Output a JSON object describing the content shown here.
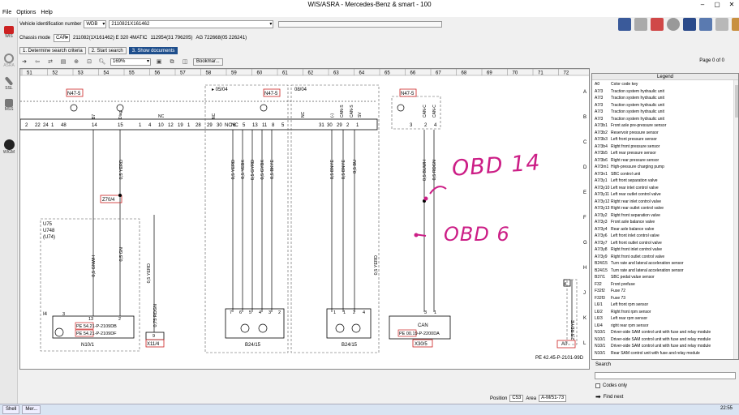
{
  "window": {
    "title": "WIS/ASRA - Mercedes-Benz & smart - 100",
    "controls": [
      "–",
      "▢",
      "✕"
    ]
  },
  "menu": [
    "File",
    "Options",
    "Help"
  ],
  "leftbar": [
    {
      "label": "WIS",
      "icon": "toolbox-icon",
      "color": "#cc2222"
    },
    {
      "label": "ASRA",
      "icon": "gauge-icon",
      "color": "#888888"
    },
    {
      "label": "SSL",
      "icon": "wrench-icon",
      "color": "#666666"
    },
    {
      "label": "MSS",
      "icon": "tools-icon",
      "color": "#666666"
    },
    {
      "label": "WIGM",
      "icon": "circle-play-icon",
      "color": "#222222"
    }
  ],
  "vin": {
    "label": "Vehicle identification number",
    "prefix": "WDB",
    "value": "2110821X161462"
  },
  "chassis": {
    "label": "Chassis mode",
    "car": "CAR",
    "model": "211082(1X161462) E 320 4MATIC",
    "engine": "112954(31 796205)",
    "trans": "AG 722668(05 226241)"
  },
  "steps": [
    {
      "label": "1. Determine search criteria",
      "active": false
    },
    {
      "label": "2. Start search",
      "active": false
    },
    {
      "label": "3. Show documents",
      "active": true
    }
  ],
  "toolbar": {
    "zoom": "169%",
    "bookmark": "Bookmar...",
    "page": "Page 0 of 0"
  },
  "diagram": {
    "col_numbers": [
      "51",
      "52",
      "53",
      "54",
      "55",
      "56",
      "57",
      "58",
      "59",
      "60",
      "61",
      "62",
      "63",
      "64",
      "65",
      "66",
      "67",
      "68",
      "69",
      "70",
      "71",
      "72"
    ],
    "row_letters": [
      "A",
      "B",
      "C",
      "D",
      "E",
      "F",
      "G",
      "H",
      "J",
      "K",
      "L"
    ],
    "boxes": [
      "N47-5",
      "N47-5",
      "N47-5"
    ],
    "sections": [
      "05/04",
      "08/04"
    ],
    "connectors_left": [
      "2",
      "22",
      "24",
      "1",
      "48",
      "14",
      "15",
      "1",
      "4",
      "10",
      "12",
      "19",
      "1",
      "28"
    ],
    "left_labels": [
      "B7",
      "Diag",
      "NC",
      "NC"
    ],
    "mid_labels": [
      "29",
      "30",
      "NC",
      "NC",
      "6",
      "5",
      "13",
      "11",
      "8",
      "5"
    ],
    "right_labels": [
      "NC",
      "(-)",
      "CAN-S",
      "CAN-S",
      "SV",
      "31",
      "30",
      "29",
      "2",
      "1",
      "3",
      "2",
      "4",
      "CAN-C",
      "CAN-C"
    ],
    "wire_labels": [
      "0,5 YERD",
      "0,5 YERD",
      "0,5 YEBK",
      "0,5 GYRD",
      "0,5 GYBK",
      "0,5 BKYE",
      "0,5 BNYE",
      "0,5 BNYE",
      "0,5 BU",
      "0,5 BUWH",
      "0,5 RDGN",
      "0,5 GNWH",
      "0,5 GN",
      "0,75 RDGN",
      "0,5 YERD",
      "0,5 YERD",
      "2,5 RDYE"
    ],
    "z_label": "Z70/4",
    "components": [
      "U75",
      "U748",
      "(U74)",
      "I4",
      "N10/1",
      "X11/4",
      "B24/15",
      "B24/15",
      "X30/5",
      "A0"
    ],
    "pe_refs": [
      "PE 54.21-P-2109DB",
      "PE 54.21-P-2109DF",
      "PE 00.19-P-2200DA",
      "PE 42.45-P-2101-99D"
    ],
    "can_label": "CAN",
    "misc_nums": [
      "13",
      "2",
      "3",
      "9",
      "7",
      "6",
      "5",
      "4",
      "3",
      "2",
      "1",
      "1",
      "2",
      "4",
      "3",
      "1",
      "4"
    ],
    "footer_ref": "PE 42.45-P-2101-99D",
    "annotations": [
      {
        "text": "OBD 14",
        "color": "#cc1e86"
      },
      {
        "text": "OBD 6",
        "color": "#cc1e86"
      }
    ]
  },
  "legend": {
    "title": "Legend",
    "items": [
      {
        "code": "A0",
        "text": "Color code key"
      },
      {
        "code": "A7/3",
        "text": "Traction system hydraulic unit"
      },
      {
        "code": "A7/3",
        "text": "Traction system hydraulic unit"
      },
      {
        "code": "A7/3",
        "text": "Traction system hydraulic unit"
      },
      {
        "code": "A7/3",
        "text": "Traction system hydraulic unit"
      },
      {
        "code": "A7/3",
        "text": "Traction system hydraulic unit"
      },
      {
        "code": "A7/3b1",
        "text": "Front axle pre-pressure sensor"
      },
      {
        "code": "A7/3b2",
        "text": "Reservoir pressure sensor"
      },
      {
        "code": "A7/3b3",
        "text": "Left front pressure sensor"
      },
      {
        "code": "A7/3b4",
        "text": "Right front pressure sensor"
      },
      {
        "code": "A7/3b5",
        "text": "Left rear pressure sensor"
      },
      {
        "code": "A7/3b6",
        "text": "Right rear pressure sensor"
      },
      {
        "code": "A7/3m1",
        "text": "High-pressure charging pump"
      },
      {
        "code": "A7/3n1",
        "text": "SBC control unit"
      },
      {
        "code": "A7/3y1",
        "text": "Left front separation valve"
      },
      {
        "code": "A7/3y10",
        "text": "Left rear inlet control valve"
      },
      {
        "code": "A7/3y11",
        "text": "Left rear outlet control valve"
      },
      {
        "code": "A7/3y12",
        "text": "Right rear inlet control valve"
      },
      {
        "code": "A7/3y13",
        "text": "Right rear outlet control valve"
      },
      {
        "code": "A7/3y2",
        "text": "Right front separation valve"
      },
      {
        "code": "A7/3y3",
        "text": "Front axle balance valve"
      },
      {
        "code": "A7/3y4",
        "text": "Rear axle balance valve"
      },
      {
        "code": "A7/3y6",
        "text": "Left front inlet control valve"
      },
      {
        "code": "A7/3y7",
        "text": "Left front outlet control valve"
      },
      {
        "code": "A7/3y8",
        "text": "Right front inlet control valve"
      },
      {
        "code": "A7/3y9",
        "text": "Right front outlet control valve"
      },
      {
        "code": "B24/15",
        "text": "Turn rate and lateral acceleration sensor"
      },
      {
        "code": "B24/15",
        "text": "Turn rate and lateral acceleration sensor"
      },
      {
        "code": "B37/1",
        "text": "SBC pedal value sensor"
      },
      {
        "code": "F32",
        "text": "Front prefuse"
      },
      {
        "code": "F32f2",
        "text": "Fuse 72"
      },
      {
        "code": "F32f3",
        "text": "Fuse 73"
      },
      {
        "code": "L6/1",
        "text": "Left front rpm sensor"
      },
      {
        "code": "L6/2",
        "text": "Right front rpm sensor"
      },
      {
        "code": "L6/3",
        "text": "Left rear rpm sensor"
      },
      {
        "code": "L6/4",
        "text": "right rear rpm sensor"
      },
      {
        "code": "N10/1",
        "text": "Driver-side SAM control unit with fuse and relay module"
      },
      {
        "code": "N10/1",
        "text": "Driver-side SAM control unit with fuse and relay module"
      },
      {
        "code": "N10/1",
        "text": "Driver-side SAM control unit with fuse and relay module"
      },
      {
        "code": "N10/1",
        "text": "Rear SAM control unit with fuse and relay module"
      }
    ]
  },
  "search": {
    "label": "Search",
    "codes_only": "Codes only",
    "find_next": "Find next"
  },
  "status": {
    "position_label": "Position",
    "position_value": "C53",
    "area_label": "Area",
    "area_value": "A-M/51-73"
  },
  "taskbar": {
    "items": [
      "Shell",
      "Mer..."
    ],
    "clock": "22:55"
  },
  "colors": {
    "accent": "#1e4e8c",
    "annotation": "#cc1e86",
    "box_red": "#cc2222"
  }
}
